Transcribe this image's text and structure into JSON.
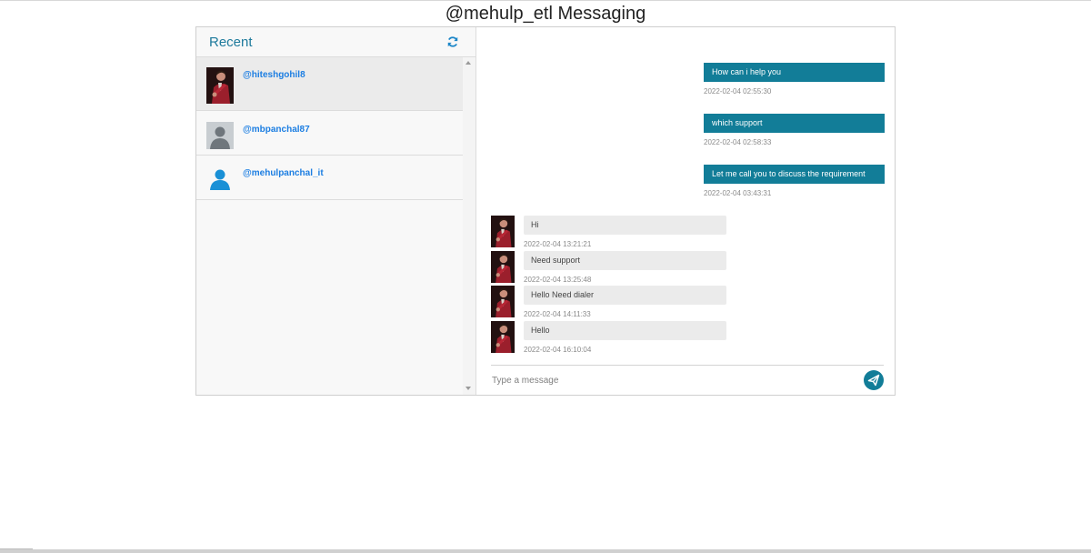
{
  "page": {
    "title": "@mehulp_etl Messaging"
  },
  "sidebar": {
    "title": "Recent",
    "refresh_icon": "refresh-icon",
    "contacts": [
      {
        "name": "@hiteshgohil8",
        "avatar": "photo-avatar",
        "active": true
      },
      {
        "name": "@mbpanchal87",
        "avatar": "default-grey-avatar",
        "active": false
      },
      {
        "name": "@mehulpanchal_it",
        "avatar": "blue-person-avatar",
        "active": false
      }
    ]
  },
  "chat": {
    "outgoing": [
      {
        "text": "How can i help you",
        "time": "2022-02-04 02:55:30"
      },
      {
        "text": "which support",
        "time": "2022-02-04 02:58:33"
      },
      {
        "text": "Let me call you to discuss the requirement",
        "time": "2022-02-04 03:43:31"
      }
    ],
    "incoming": [
      {
        "text": "Hi",
        "time": "2022-02-04 13:21:21"
      },
      {
        "text": "Need support",
        "time": "2022-02-04 13:25:48"
      },
      {
        "text": "Hello Need dialer",
        "time": "2022-02-04 14:11:33"
      },
      {
        "text": "Hello",
        "time": "2022-02-04 16:10:04"
      }
    ],
    "input_placeholder": "Type a message",
    "send_icon": "paper-plane-icon"
  },
  "colors": {
    "accent": "#127d98",
    "link": "#1c7ee2",
    "header": "#1e7a9c",
    "incoming_bubble": "#ebebeb"
  }
}
